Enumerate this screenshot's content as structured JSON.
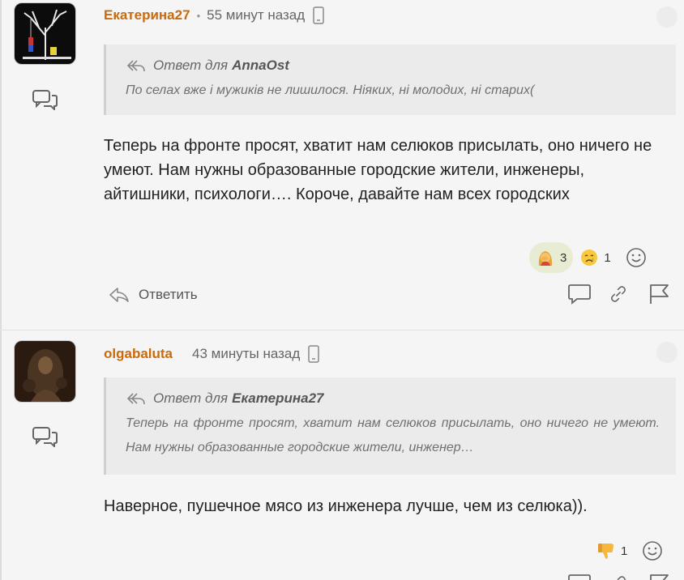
{
  "comments": [
    {
      "author": "Екатерина27",
      "separator": "•",
      "time": "55 минут назад",
      "reply_prefix": "Ответ для",
      "reply_to": "AnnaOst",
      "quote": "По селах вже і мужиків не лишилося. Ніяких, ні молодих, ні старих(",
      "body": "Теперь на фронте просят, хватит нам селюков присылать, оно ничего не умеют. Нам нужны образованные городские жители, инженеры, айтишники, психологи…. Короче, давайте нам всех городских",
      "reactions": [
        {
          "emoji": "woman-facepalming",
          "count": "3",
          "active": true
        },
        {
          "emoji": "crying-face",
          "count": "1",
          "active": false
        }
      ],
      "reply_label": "Ответить"
    },
    {
      "author": "olgabaluta",
      "time": "43 минуты назад",
      "reply_prefix": "Ответ для",
      "reply_to": "Екатерина27",
      "quote": "Теперь на фронте просят, хватит нам селюков присылать, оно ничего не умеют. Нам нужны образованные городские жители, инженер…",
      "body": "Наверное, пушечное мясо из инженера лучше, чем из селюка)).",
      "reactions": [
        {
          "emoji": "thumbs-down",
          "count": "1",
          "active": false
        }
      ]
    }
  ],
  "colors": {
    "author": "#c96a0c",
    "reaction_active_bg": "#e7ecd3",
    "quote_bg": "#ebebeb"
  }
}
